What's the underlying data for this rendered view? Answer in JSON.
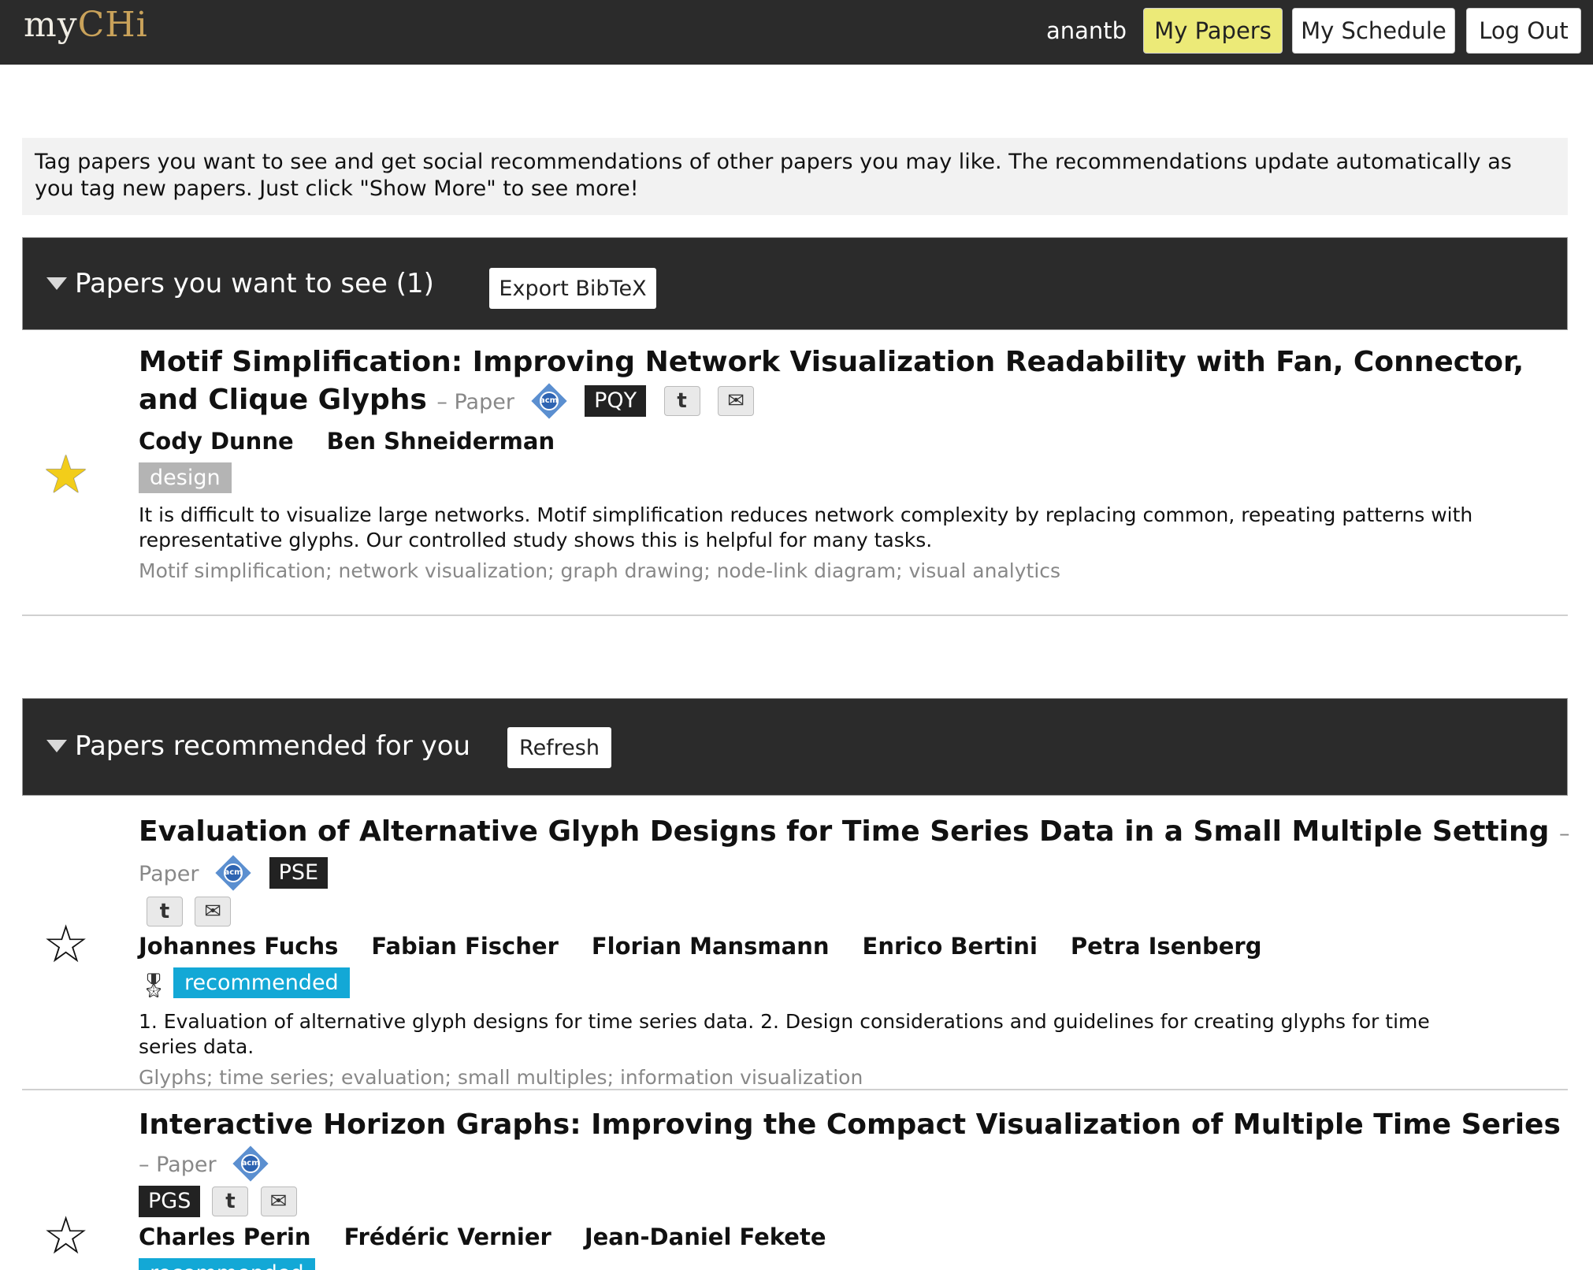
{
  "app": {
    "logo_prefix": "my",
    "logo_suffix": "CHi",
    "username": "anantb",
    "nav": {
      "my_papers": "My Papers",
      "my_schedule": "My Schedule",
      "log_out": "Log Out"
    }
  },
  "intro": "Tag papers you want to see and get social recommendations of other papers you may like. The recommendations update automatically as you tag new papers. Just click \"Show More\" to see more!",
  "section_want": {
    "title": "Papers you want to see (1)",
    "button": "Export BibTeX",
    "papers": [
      {
        "title": "Motif Simplification: Improving Network Visualization Readability with Fan, Connector, and Clique Glyphs",
        "type": "– Paper",
        "code": "PQY",
        "authors": [
          "Cody Dunne",
          "Ben Shneiderman"
        ],
        "tag": "design",
        "abstract": "It is difficult to visualize large networks. Motif simplification reduces network complexity by replacing common, repeating patterns with representative glyphs. Our controlled study shows this is helpful for many tasks.",
        "keywords": "Motif simplification; network visualization; graph drawing; node-link diagram; visual analytics",
        "starred": true
      }
    ]
  },
  "section_rec": {
    "title": "Papers recommended for you",
    "button": "Refresh",
    "papers": [
      {
        "title": "Evaluation of Alternative Glyph Designs for Time Series Data in a Small Multiple Setting",
        "type": "– Paper",
        "code": "PSE",
        "authors": [
          "Johannes Fuchs",
          "Fabian Fischer",
          "Florian Mansmann",
          "Enrico Bertini",
          "Petra Isenberg"
        ],
        "tag": "recommended",
        "abstract": "1. Evaluation of alternative glyph designs for time series data. 2. Design considerations and guidelines for creating glyphs for time series data.",
        "keywords": "Glyphs; time series; evaluation; small multiples; information visualization",
        "starred": false
      },
      {
        "title": "Interactive Horizon Graphs: Improving the Compact Visualization of Multiple Time Series",
        "type": "– Paper",
        "code": "PGS",
        "authors": [
          "Charles Perin",
          "Frédéric Vernier",
          "Jean-Daniel Fekete"
        ],
        "tag": "recommended",
        "starred": false
      }
    ]
  },
  "icons": {
    "acm_badge": "acm",
    "twitter_glyph": "t",
    "mail_glyph": "✉",
    "medal_glyph": "🎖",
    "star_filled": "★",
    "star_empty": "☆"
  },
  "colors": {
    "header_bg": "#2b2b2b",
    "active_nav": "#ecea78",
    "tag_design": "#b4b4b4",
    "tag_recommended": "#13a8d6",
    "star_filled": "#f2cd1a"
  }
}
